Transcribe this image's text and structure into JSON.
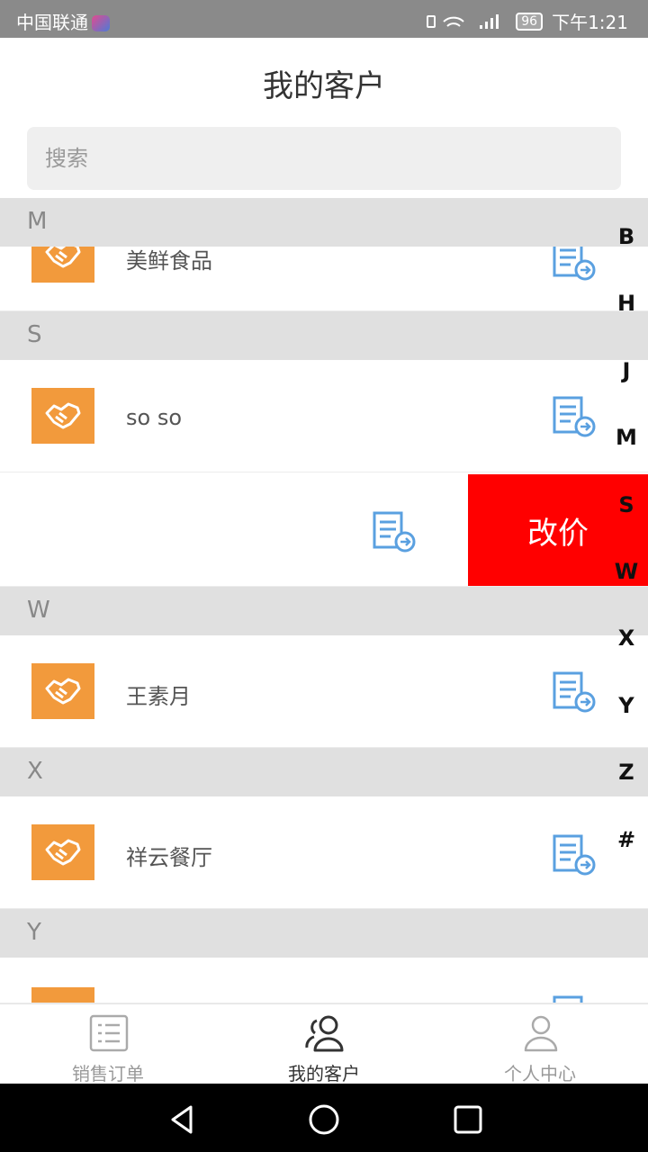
{
  "status_bar": {
    "carrier": "中国联通",
    "battery": "96",
    "time": "下午1:21"
  },
  "header": {
    "title": "我的客户"
  },
  "search": {
    "placeholder": "搜索"
  },
  "sections": [
    {
      "letter": "M",
      "customers": [
        {
          "name": "美鲜食品"
        }
      ]
    },
    {
      "letter": "S",
      "customers": [
        {
          "name": "so so"
        },
        {
          "name": ""
        }
      ]
    },
    {
      "letter": "W",
      "customers": [
        {
          "name": "王素月"
        }
      ]
    },
    {
      "letter": "X",
      "customers": [
        {
          "name": "祥云餐厅"
        }
      ]
    },
    {
      "letter": "Y",
      "customers": []
    }
  ],
  "swipe_action": {
    "label": "改价",
    "color": "#ff0000"
  },
  "alphabet_index": [
    "B",
    "H",
    "J",
    "M",
    "S",
    "W",
    "X",
    "Y",
    "Z",
    "#"
  ],
  "tabs": [
    {
      "label": "销售订单",
      "icon": "list-icon",
      "active": false
    },
    {
      "label": "我的客户",
      "icon": "customers-icon",
      "active": true
    },
    {
      "label": "个人中心",
      "icon": "person-icon",
      "active": false
    }
  ],
  "colors": {
    "accent_orange": "#f29a3c",
    "icon_blue": "#5aa0e0",
    "section_bg": "#e0e0e0"
  }
}
